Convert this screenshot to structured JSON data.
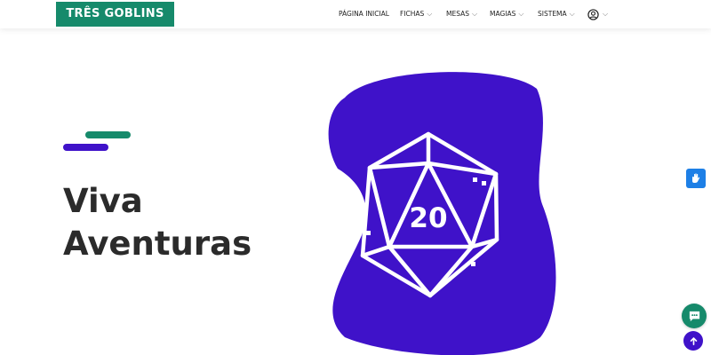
{
  "brand": {
    "name": "TRÊS GOBLINS"
  },
  "nav": {
    "items": [
      {
        "label": "PÁGINA INICIAL",
        "dropdown": false
      },
      {
        "label": "FICHAS",
        "dropdown": true
      },
      {
        "label": "MESAS",
        "dropdown": true
      },
      {
        "label": "MAGIAS",
        "dropdown": true
      },
      {
        "label": "SISTEMA",
        "dropdown": true
      }
    ],
    "user_icon": "user-circle-icon"
  },
  "hero": {
    "headline_line1": "Viva",
    "headline_line2": "Aventuras",
    "die_value": "20"
  },
  "floating": {
    "accessibility_icon": "sign-language-icon",
    "chat_icon": "chat-icon",
    "back_to_top_icon": "arrow-up-icon"
  },
  "colors": {
    "brand_green": "#168a6b",
    "accent_purple": "#3f12c9",
    "text_dark": "#2b2b2b",
    "a11y_blue": "#1d7fe6"
  }
}
